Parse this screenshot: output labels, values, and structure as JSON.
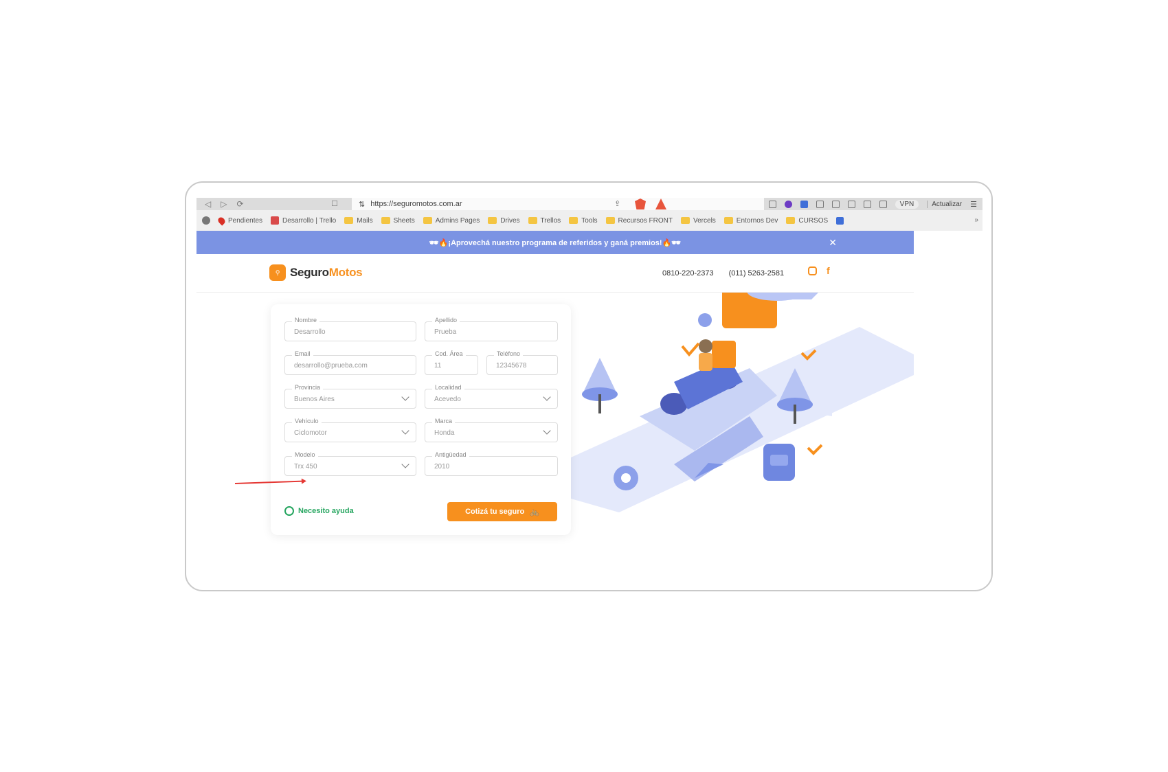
{
  "browser": {
    "nav": {
      "back": "◁",
      "forward": "▷",
      "reload": "⟳"
    },
    "url": "https://seguromotos.com.ar",
    "vpn_label": "VPN",
    "update_label": "Actualizar",
    "menu_icon": "☰"
  },
  "bookmarks": [
    {
      "label": "",
      "icon": "github-icon"
    },
    {
      "label": "Pendientes",
      "icon": "pin-icon"
    },
    {
      "label": "Desarrollo | Trello",
      "icon": "trello-icon"
    },
    {
      "label": "Mails",
      "icon": "folder-icon"
    },
    {
      "label": "Sheets",
      "icon": "folder-icon"
    },
    {
      "label": "Admins Pages",
      "icon": "folder-icon"
    },
    {
      "label": "Drives",
      "icon": "folder-icon"
    },
    {
      "label": "Trellos",
      "icon": "folder-icon"
    },
    {
      "label": "Tools",
      "icon": "folder-icon"
    },
    {
      "label": "Recursos FRONT",
      "icon": "folder-icon"
    },
    {
      "label": "Vercels",
      "icon": "folder-icon"
    },
    {
      "label": "Entornos Dev",
      "icon": "folder-icon"
    },
    {
      "label": "CURSOS",
      "icon": "folder-icon"
    }
  ],
  "promo": {
    "text": "🕶🔥¡Aprovechá nuestro programa de referidos y ganá premios!🔥🕶",
    "close": "✕"
  },
  "header": {
    "logo_text": "Seguro",
    "logo_accent": "Motos",
    "phone_1": "0810-220-2373",
    "phone_2": "(011) 5263-2581"
  },
  "form": {
    "fields": [
      {
        "label": "Nombre",
        "value": "Desarrollo",
        "select": false
      },
      {
        "label": "Apellido",
        "value": "Prueba",
        "select": false
      },
      {
        "label": "Email",
        "value": "desarrollo@prueba.com",
        "select": false
      },
      {
        "label": "Cod. Área",
        "value": "11",
        "select": false
      },
      {
        "label": "Teléfono",
        "value": "12345678",
        "select": false
      },
      {
        "label": "Provincia",
        "value": "Buenos Aires",
        "select": true
      },
      {
        "label": "Localidad",
        "value": "Acevedo",
        "select": true
      },
      {
        "label": "Vehículo",
        "value": "Ciclomotor",
        "select": true
      },
      {
        "label": "Marca",
        "value": "Honda",
        "select": true
      },
      {
        "label": "Modelo",
        "value": "Trx 450",
        "select": true
      },
      {
        "label": "Antigüedad",
        "value": "2010",
        "select": false
      }
    ],
    "help_label": "Necesito ayuda",
    "cta_label": "Cotizá tu seguro",
    "cta_icon": "🚲"
  },
  "colors": {
    "brand_orange": "#f7901e",
    "promo_blue": "#7b93e3",
    "whatsapp_green": "#25a55f",
    "annotation_red": "#e53935"
  }
}
